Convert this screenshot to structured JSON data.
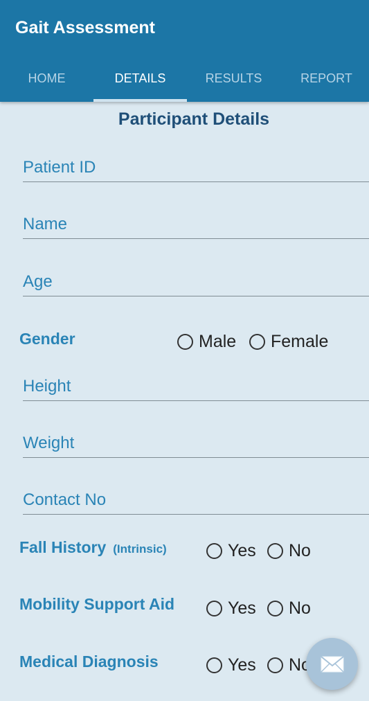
{
  "app": {
    "title": "Gait Assessment"
  },
  "tabs": [
    {
      "label": "HOME"
    },
    {
      "label": "DETAILS"
    },
    {
      "label": "RESULTS"
    },
    {
      "label": "REPORT"
    }
  ],
  "section_title": "Participant Details",
  "fields": {
    "patient_id": {
      "placeholder": "Patient ID",
      "value": ""
    },
    "name": {
      "placeholder": "Name",
      "value": ""
    },
    "age": {
      "placeholder": "Age",
      "value": ""
    },
    "height": {
      "placeholder": "Height",
      "value": ""
    },
    "weight": {
      "placeholder": "Weight",
      "value": ""
    },
    "contact": {
      "placeholder": "Contact No",
      "value": ""
    }
  },
  "gender": {
    "label": "Gender",
    "options": [
      "Male",
      "Female"
    ]
  },
  "fall_history": {
    "label": "Fall History",
    "sub": "(Intrinsic)",
    "options": [
      "Yes",
      "No"
    ]
  },
  "mobility_aid": {
    "label": "Mobility Support Aid",
    "options": [
      "Yes",
      "No"
    ]
  },
  "medical_diagnosis": {
    "label": "Medical Diagnosis",
    "options": [
      "Yes",
      "No"
    ]
  },
  "fab": {
    "icon": "mail-icon"
  },
  "colors": {
    "app_bar": "#1c76a6",
    "background": "#dce9f1",
    "accent_text": "#2a84b6",
    "title_text": "#1f4f78",
    "fab": "#a8c3d9"
  }
}
